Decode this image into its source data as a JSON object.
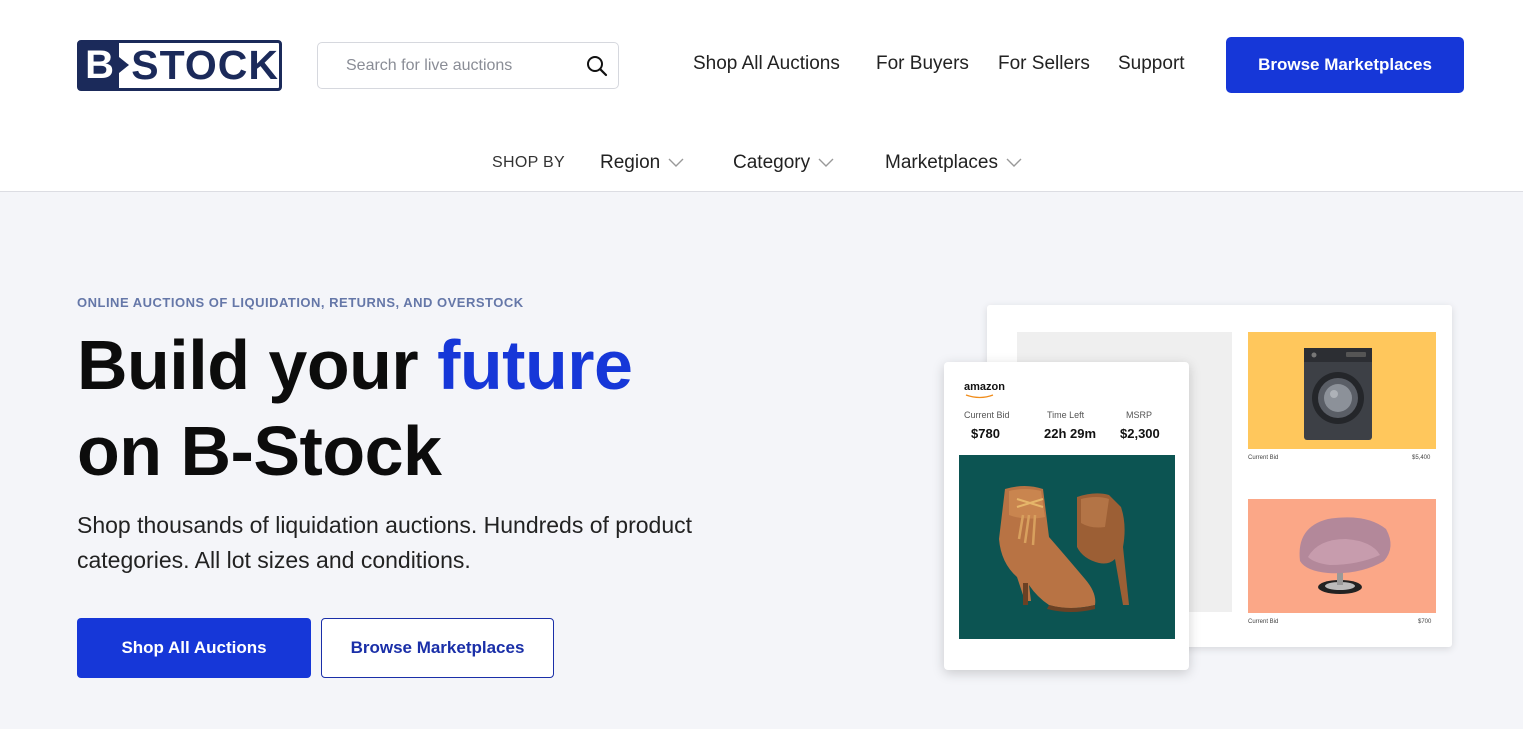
{
  "header": {
    "logo_text": "B-STOCK",
    "search": {
      "placeholder": "Search for live auctions",
      "value": ""
    },
    "nav": [
      "Shop All Auctions",
      "For Buyers",
      "For Sellers",
      "Support"
    ],
    "cta_label": "Browse Marketplaces"
  },
  "shop_by": {
    "label": "SHOP BY",
    "dropdowns": [
      "Region",
      "Category",
      "Marketplaces"
    ]
  },
  "hero": {
    "eyebrow": "ONLINE AUCTIONS OF LIQUIDATION, RETURNS, AND OVERSTOCK",
    "headline_part1": "Build your ",
    "headline_highlight": "future",
    "headline_part2": "on B-Stock",
    "subtext": "Shop thousands of liquidation auctions. Hundreds of product categories. All lot sizes and conditions.",
    "primary_button": "Shop All Auctions",
    "secondary_button": "Browse Marketplaces"
  },
  "illustration": {
    "front_card": {
      "brand": "amazon",
      "stats": [
        {
          "label": "Current Bid",
          "value": "$780"
        },
        {
          "label": "Time Left",
          "value": "22h 29m"
        },
        {
          "label": "MSRP",
          "value": "$2,300"
        }
      ]
    },
    "back_card": {
      "tiles": [
        {
          "caption": "Current Bid",
          "value": "$5,400"
        },
        {
          "caption": "Current Bid",
          "value": "$700"
        }
      ]
    }
  },
  "colors": {
    "brand_blue": "#1637d8",
    "navy": "#1b2a5a",
    "hero_bg": "#f4f5f9"
  }
}
